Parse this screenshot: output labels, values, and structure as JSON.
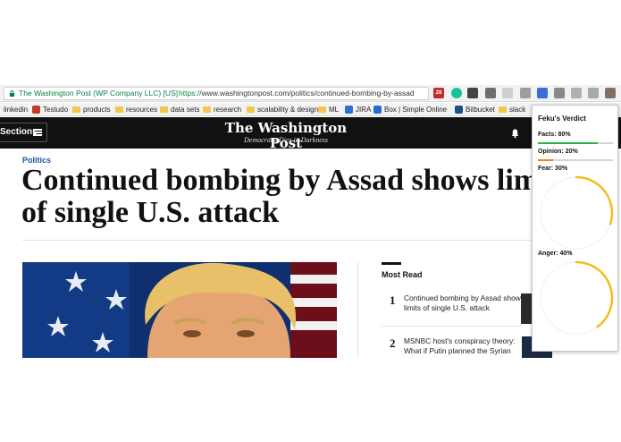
{
  "browser": {
    "site_identity": "The Washington Post (WP Company LLC) [US]",
    "url_scheme": "https://",
    "url_rest": "www.washingtonpost.com/politics/continued-bombing-by-assad",
    "ext_badge": "28"
  },
  "bookmarks": [
    {
      "label": "linkedin"
    },
    {
      "label": "Testudo"
    },
    {
      "label": "products"
    },
    {
      "label": "resources"
    },
    {
      "label": "data sets"
    },
    {
      "label": "research"
    },
    {
      "label": "scalability & design"
    },
    {
      "label": "ML"
    },
    {
      "label": "JIRA"
    },
    {
      "label": "Box | Simple Online C"
    },
    {
      "label": "Bitbucket"
    },
    {
      "label": "slack"
    }
  ],
  "nav": {
    "sections_label": "Sections",
    "logo": "The Washington Post",
    "tagline": "Democracy Dies in Darkness"
  },
  "article": {
    "kicker": "Politics",
    "headline_line1": "Continued bombing by Assad shows limits",
    "headline_line2": "of single U.S. attack"
  },
  "most_read": {
    "title": "Most Read",
    "items": [
      {
        "num": "1",
        "text": "Continued bombing by Assad shows limits of single U.S. attack"
      },
      {
        "num": "2",
        "text": "MSNBC host's conspiracy theory: What if Putin planned the Syrian"
      }
    ]
  },
  "verdict": {
    "title": "Feku's Verdict",
    "facts_label": "Facts: 80%",
    "facts_value": 0.8,
    "opinion_label": "Opinion: 20%",
    "opinion_value": 0.2,
    "fear_label": "Fear: 30%",
    "fear_value": 0.3,
    "anger_label": "Anger: 40%",
    "anger_value": 0.4,
    "facts_color": "#2fb04b",
    "opinion_color": "#e58a2b",
    "gauge_color": "#f2bd1d"
  }
}
